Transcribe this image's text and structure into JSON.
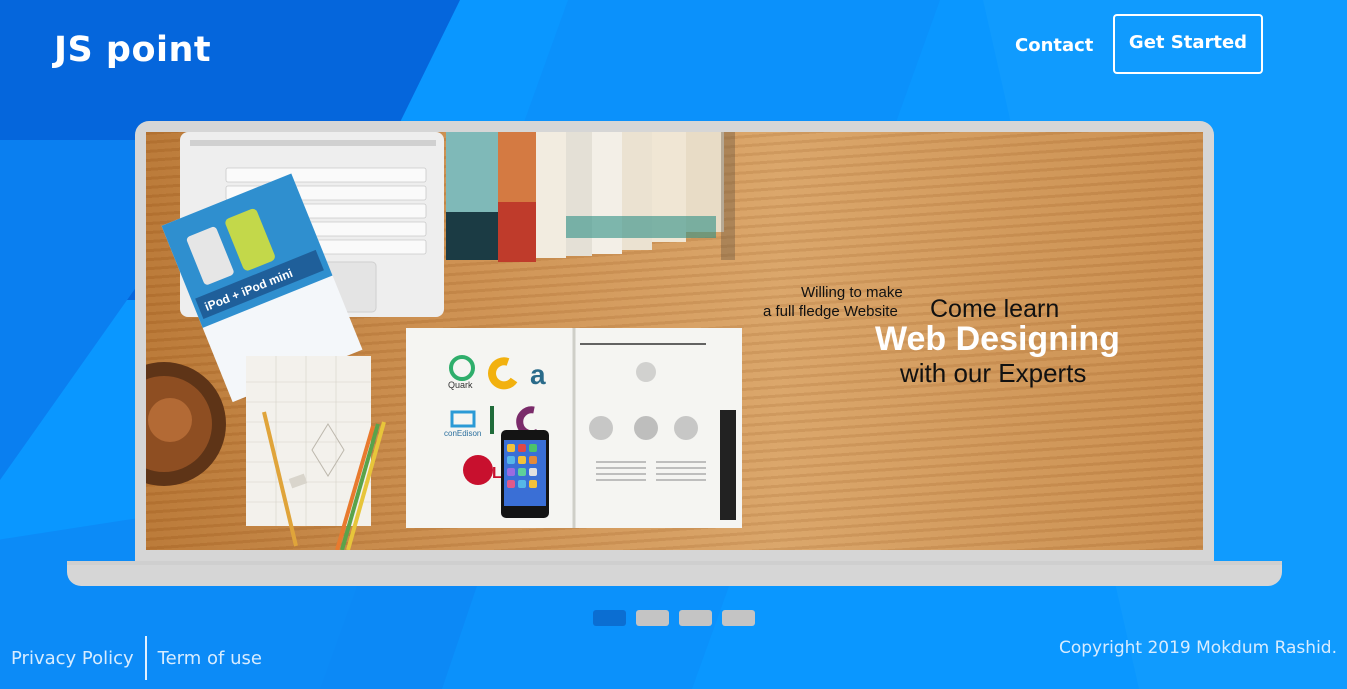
{
  "header": {
    "logo": "JS point",
    "nav": {
      "contact": "Contact",
      "get_started": "Get Started"
    }
  },
  "slider": {
    "active_index": 0,
    "slide_count": 4,
    "slide": {
      "line1": "Willing to make",
      "line2": "a full fledge Website",
      "line3": "Come learn",
      "line4": "Web Designing",
      "line5": "with our Experts",
      "props": {
        "booklet_title": "iPod + iPod mini",
        "logos": [
          "Quark",
          "conEdison",
          "LG"
        ]
      }
    }
  },
  "footer": {
    "links": [
      "Privacy Policy",
      "Term of use"
    ],
    "copyright": "Copyright 2019 Mokdum Rashid."
  },
  "colors": {
    "background": "#0a97ff",
    "background_dark": "#0566dc",
    "indicator_active": "#0b6ed2",
    "indicator_inactive": "#c4c4c4",
    "laptop_frame": "#d6d6d6"
  }
}
